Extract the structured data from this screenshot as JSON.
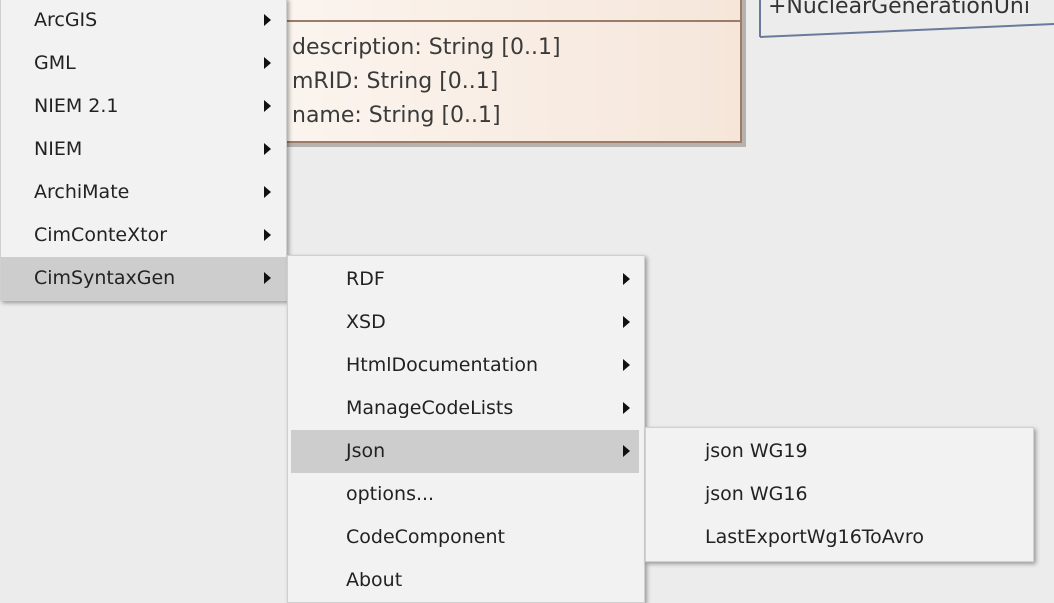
{
  "diagram": {
    "attributes": [
      "description: String [0..1]",
      "mRID: String [0..1]",
      "name: String [0..1]"
    ],
    "association_label": "+NuclearGenerationUni"
  },
  "main_menu": {
    "items": [
      {
        "label": "ArcGIS"
      },
      {
        "label": "GML"
      },
      {
        "label": "NIEM 2.1"
      },
      {
        "label": "NIEM"
      },
      {
        "label": "ArchiMate"
      },
      {
        "label": "CimConteXtor"
      },
      {
        "label": "CimSyntaxGen"
      }
    ],
    "selected": "CimSyntaxGen"
  },
  "cimsyntaxgen_menu": {
    "items": [
      {
        "label": "RDF"
      },
      {
        "label": "XSD"
      },
      {
        "label": "HtmlDocumentation"
      },
      {
        "label": "ManageCodeLists"
      },
      {
        "label": "Json"
      },
      {
        "label": "options..."
      },
      {
        "label": "CodeComponent"
      },
      {
        "label": "About"
      }
    ],
    "selected": "Json"
  },
  "json_menu": {
    "items": [
      {
        "label": "json WG19"
      },
      {
        "label": "json WG16"
      },
      {
        "label": "LastExportWg16ToAvro"
      }
    ]
  },
  "colors": {
    "menu_background": "#f2f2f2",
    "menu_selected": "#cdcdcd",
    "class_fill_start": "#fbf5ef",
    "class_fill_end": "#f6e6da",
    "class_border": "#9c7c68",
    "canvas": "#ececec"
  }
}
